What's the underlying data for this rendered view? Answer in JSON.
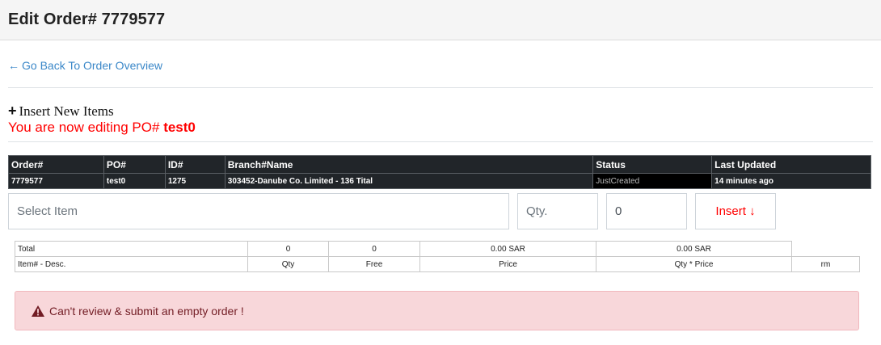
{
  "header": {
    "title": "Edit Order# 7779577"
  },
  "nav": {
    "back_arrow": "←",
    "back_link": "Go Back To Order Overview"
  },
  "insert_section": {
    "plus_glyph": "+",
    "title": "Insert New Items",
    "editing_prefix": "You are now editing PO#",
    "editing_po": "test0"
  },
  "order_table": {
    "headers": [
      "Order#",
      "PO#",
      "ID#",
      "Branch#Name",
      "Status",
      "Last Updated"
    ],
    "row": [
      "7779577",
      "test0",
      "1275",
      "303452-Danube Co. Limited - 136 Tital",
      "JustCreated",
      "14 minutes ago"
    ]
  },
  "inputs": {
    "item_placeholder": "Select Item",
    "qty_placeholder": "Qty.",
    "zero_value": "0",
    "insert_label": "Insert",
    "insert_arrow": "↓"
  },
  "totals_table": {
    "total_row": [
      "Total",
      "0",
      "0",
      "0.00 SAR",
      "0.00 SAR"
    ],
    "header_row": [
      "Item# - Desc.",
      "Qty",
      "Free",
      "Price",
      "Qty * Price",
      "rm"
    ]
  },
  "alert": {
    "message": "Can't review & submit an empty order !",
    "icon": "warning-icon"
  },
  "colors": {
    "link": "#3a87c8",
    "accent_red": "#ff0000",
    "table_dark": "#212529",
    "alert_bg": "#f8d7da",
    "alert_text": "#721c24"
  }
}
